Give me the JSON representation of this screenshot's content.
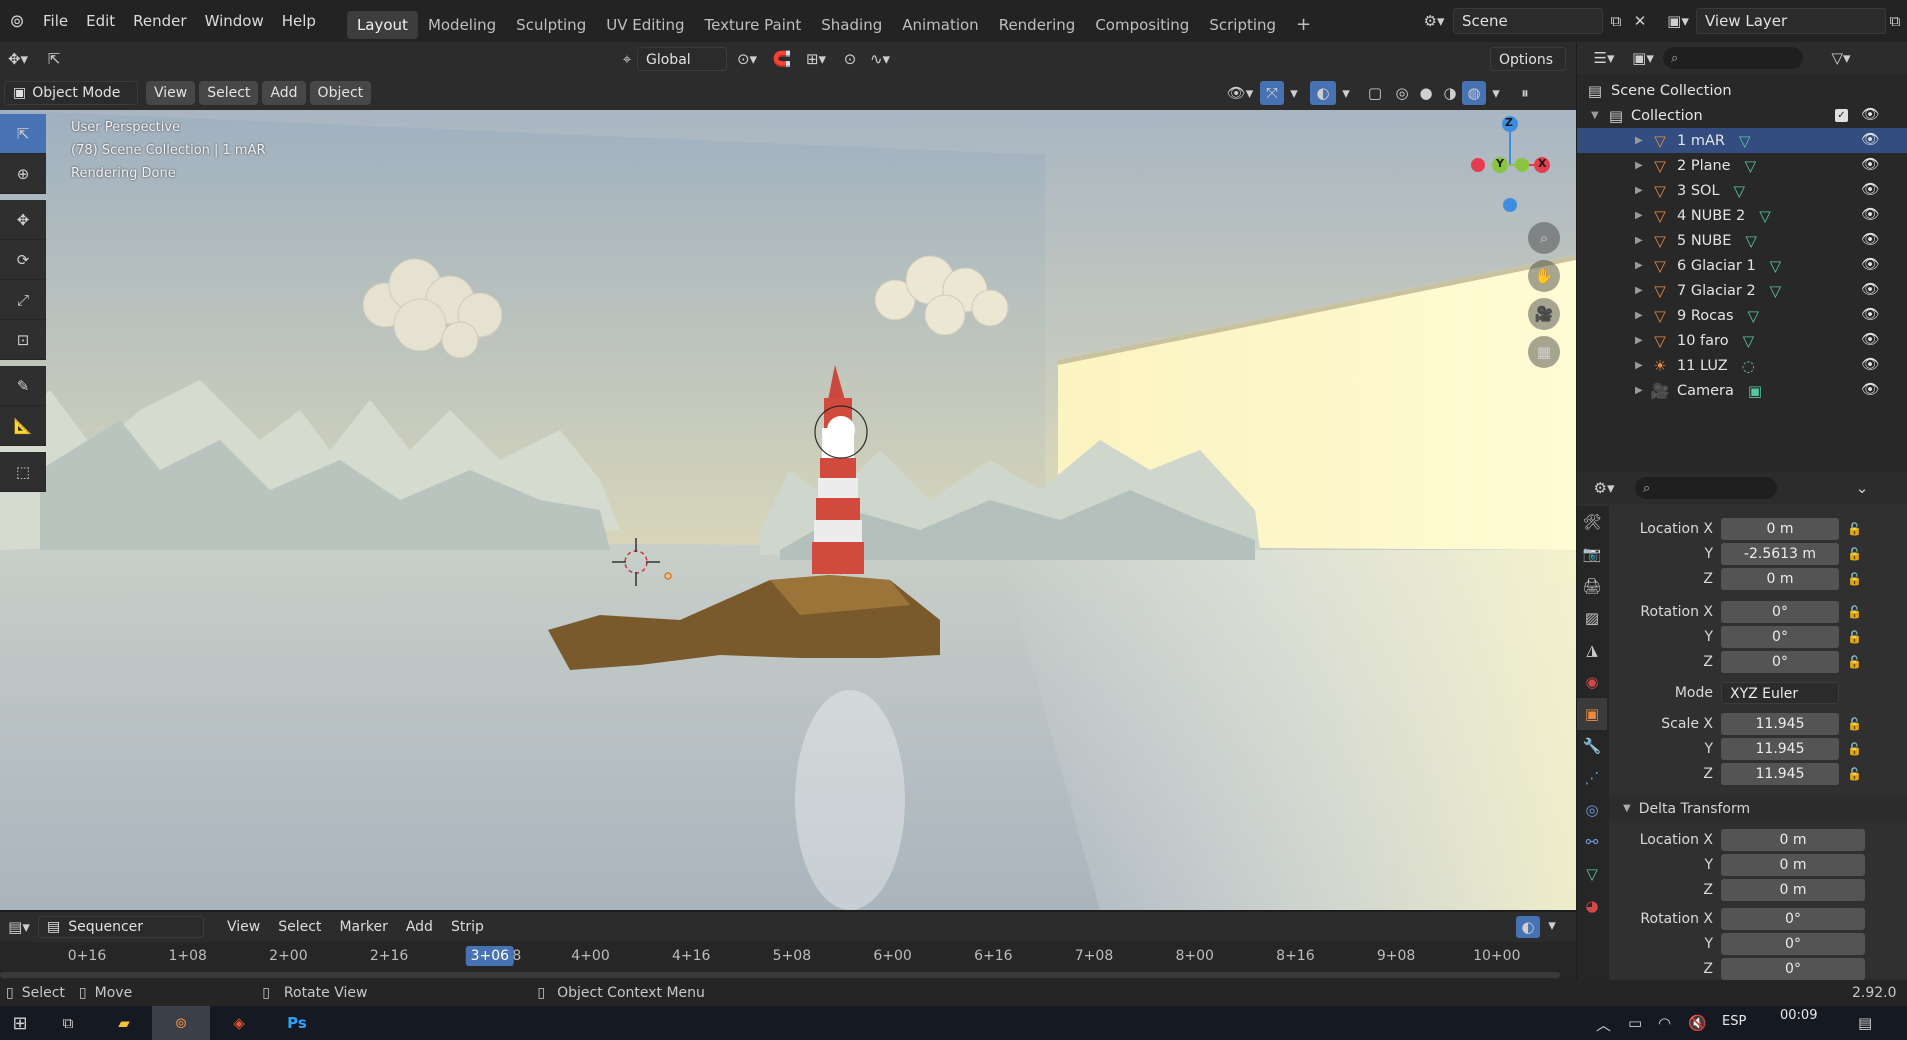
{
  "menubar": {
    "items": [
      "File",
      "Edit",
      "Render",
      "Window",
      "Help"
    ],
    "workspaces": [
      "Layout",
      "Modeling",
      "Sculpting",
      "UV Editing",
      "Texture Paint",
      "Shading",
      "Animation",
      "Rendering",
      "Compositing",
      "Scripting"
    ],
    "active_workspace": "Layout",
    "add_tab": "+",
    "scene": "Scene",
    "view_layer": "View Layer"
  },
  "tool_header": {
    "orientation": "Global",
    "options": "Options"
  },
  "viewport_header": {
    "mode": "Object Mode",
    "menus": [
      "View",
      "Select",
      "Add",
      "Object"
    ]
  },
  "viewport_overlay": {
    "line1": "User Perspective",
    "line2": "(78) Scene Collection | 1 mAR",
    "line3": "Rendering Done"
  },
  "gizmo": {
    "z": "Z",
    "y": "Y",
    "x": "X"
  },
  "outliner": {
    "root": "Scene Collection",
    "collection": "Collection",
    "items": [
      {
        "label": "1 mAR",
        "selected": true,
        "type": "mesh"
      },
      {
        "label": "2 Plane",
        "type": "mesh"
      },
      {
        "label": "3 SOL",
        "type": "mesh"
      },
      {
        "label": "4 NUBE 2",
        "type": "mesh"
      },
      {
        "label": "5  NUBE",
        "type": "mesh"
      },
      {
        "label": "6 Glaciar 1",
        "type": "mesh"
      },
      {
        "label": "7 Glaciar 2",
        "type": "mesh"
      },
      {
        "label": "9 Rocas",
        "type": "mesh"
      },
      {
        "label": "10 faro",
        "type": "mesh"
      },
      {
        "label": "11 LUZ",
        "type": "light"
      },
      {
        "label": "Camera",
        "type": "camera"
      }
    ]
  },
  "properties": {
    "location_label": "Location X",
    "rotation_label": "Rotation X",
    "scale_label": "Scale X",
    "mode_label": "Mode",
    "y": "Y",
    "z": "Z",
    "location": [
      "0 m",
      "-2.5613 m",
      "0 m"
    ],
    "rotation": [
      "0°",
      "0°",
      "0°"
    ],
    "mode": "XYZ Euler",
    "scale": [
      "11.945",
      "11.945",
      "11.945"
    ],
    "delta_title": "Delta Transform",
    "delta_location": [
      "0 m",
      "0 m",
      "0 m"
    ],
    "delta_rotation": [
      "0°",
      "0°",
      "0°"
    ]
  },
  "sequencer": {
    "editor": "Sequencer",
    "menus": [
      "View",
      "Select",
      "Marker",
      "Add",
      "Strip"
    ],
    "ticks": [
      "0+16",
      "1+08",
      "2+00",
      "2+16",
      "3+06",
      "4+00",
      "4+16",
      "5+08",
      "6+00",
      "6+16",
      "7+08",
      "8+00",
      "8+16",
      "9+08",
      "10+00"
    ],
    "current_frame": "3+06",
    "current_frame_tail": "8"
  },
  "statusbar": {
    "select": "Select",
    "move": "Move",
    "rotate": "Rotate View",
    "context": "Object Context Menu",
    "version": "2.92.0"
  },
  "taskbar": {
    "language": "ESP",
    "time": "00:09"
  },
  "colors": {
    "accent": "#4772b3",
    "selected_row": "#334d80",
    "mesh_icon": "#e98a3c",
    "data_icon": "#59c6a3",
    "gizmo_x": "#e33d4f",
    "gizmo_y": "#8bc43f",
    "gizmo_z": "#3d8ee3"
  }
}
